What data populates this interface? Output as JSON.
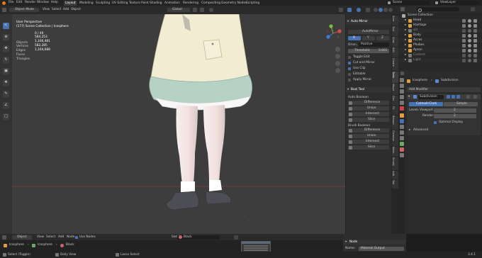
{
  "topbar": {
    "menus": [
      "File",
      "Edit",
      "Render",
      "Window",
      "Help"
    ],
    "workspaces": [
      "Layout",
      "Modeling",
      "Sculpting",
      "UV Editing",
      "Texture Paint",
      "Shading",
      "Animation",
      "Rendering",
      "Compositing",
      "Geometry Nodes",
      "Scripting"
    ],
    "active_workspace": "Layout",
    "scene_label": "Scene",
    "viewlayer_label": "ViewLayer"
  },
  "viewport_header": {
    "mode": "Object Mode",
    "menus": [
      "View",
      "Select",
      "Add",
      "Object"
    ],
    "orientation": "Global"
  },
  "viewport_info": {
    "perspective": "User Perspective",
    "collection": "(177) Scene Collection | Icosphere",
    "stats": [
      {
        "label": "Objects",
        "value": "0 / 49"
      },
      {
        "label": "Vertices",
        "value": "584,253"
      },
      {
        "label": "Edges",
        "value": "1,166,481"
      },
      {
        "label": "Faces",
        "value": "582,285"
      },
      {
        "label": "Triangles",
        "value": "1,164,688"
      }
    ]
  },
  "npanel": {
    "auto_mirror_title": "Auto Mirror",
    "auto_mirror_btn": "AutoMirror",
    "axes": [
      "X",
      "Y",
      "Z"
    ],
    "orientation_label": "Orien...",
    "orientation_value": "Positive",
    "threshold_label": "Threshold",
    "threshold_value": "0.001",
    "checks": [
      {
        "label": "Toggle Edit",
        "on": false
      },
      {
        "label": "Cut and Mirror",
        "on": true
      },
      {
        "label": "Use Clip",
        "on": true
      },
      {
        "label": "Editable",
        "on": false
      },
      {
        "label": "Apply Mirror",
        "on": false
      }
    ],
    "booltool_title": "Bool Tool",
    "auto_boolean_label": "Auto Boolean",
    "auto_ops": [
      "Difference",
      "Union",
      "Intersect",
      "Slice"
    ],
    "brush_boolean_label": "Brush Boolean",
    "brush_ops": [
      "Difference",
      "Union",
      "Intersect",
      "Slice"
    ]
  },
  "ntabs": [
    "Item",
    "Tool",
    "View",
    "Edit",
    "Create",
    "Tools",
    "Magic",
    "Geo",
    "Fit",
    "Retopo",
    "Cleanup",
    "Mesh",
    "Simply",
    "Add",
    "Tab"
  ],
  "outliner": {
    "title": "Scene Collection",
    "items": [
      {
        "label": "Head",
        "color": "#e0a040"
      },
      {
        "label": "Hairtage",
        "color": "#e0a040"
      },
      {
        "label": "sill",
        "color": "#7a7a7a"
      },
      {
        "label": "Body",
        "color": "#e0a040"
      },
      {
        "label": "Acces",
        "color": "#e0a040"
      },
      {
        "label": "Phobes",
        "color": "#e0a040"
      },
      {
        "label": "Apron",
        "color": "#e0a040"
      },
      {
        "label": "Content",
        "color": "#7a7a7a"
      },
      {
        "label": "Light",
        "color": "#7a7a7a"
      }
    ]
  },
  "properties": {
    "object_name": "Icosphere",
    "modifier_name": "Subdivision",
    "add_modifier": "Add Modifier",
    "mod_title": "Subdivision",
    "tab_catmull": "Catmull-Clark",
    "tab_simple": "Simple",
    "levels_viewport_label": "Levels Viewport",
    "levels_viewport_value": "2",
    "render_label": "Render",
    "render_value": "2",
    "optimal_display": "Optimal Display",
    "advanced": "Advanced"
  },
  "node_header": {
    "type": "Object",
    "menus": [
      "View",
      "Select",
      "Add",
      "Node"
    ],
    "use_nodes": "Use Nodes",
    "slot": "Slot 1",
    "material": "Black"
  },
  "breadcrumb": [
    "Icosphere",
    "Icosphere",
    "Black"
  ],
  "node_side": {
    "title": "Node",
    "name_label": "Name:",
    "name_value": "Material Output"
  },
  "statusbar": {
    "items": [
      "Select (Toggle)",
      "Dolly View",
      "Lasso Select"
    ],
    "version": "3.4.1"
  },
  "colors": {
    "accent": "#4772b3",
    "skirt_cream": "#f2ecd2",
    "skirt_mint": "#b6d2c4",
    "skin": "#f3e7e5",
    "shoe": "#4d4d55"
  }
}
